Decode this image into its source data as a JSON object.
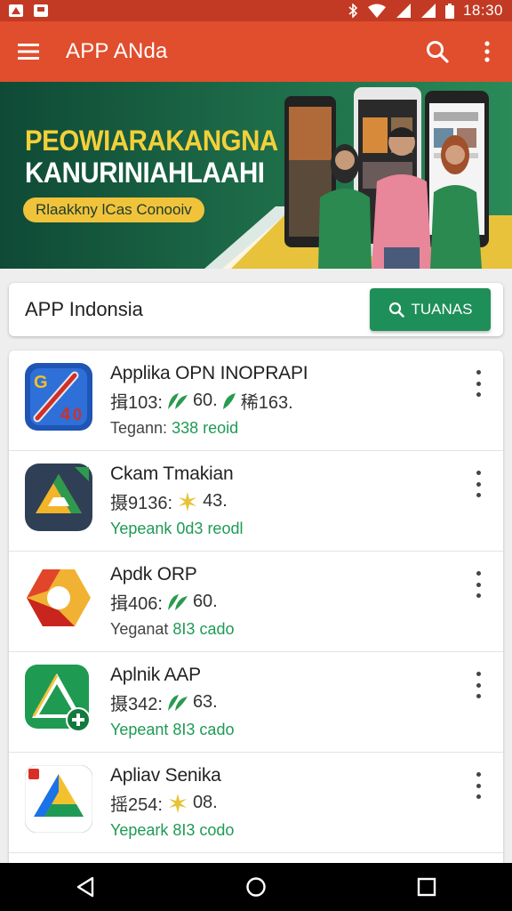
{
  "status_bar": {
    "time": "18:30",
    "icons": [
      "app-notification-icon",
      "image-notification-icon",
      "bluetooth-icon",
      "wifi-icon",
      "signal-icon",
      "signal-icon",
      "battery-icon"
    ]
  },
  "app_bar": {
    "title": "APP ANda",
    "menu_icon": "menu-icon",
    "search_icon": "search-icon",
    "more_icon": "more-vert-icon",
    "color": "#e04e2d"
  },
  "banner": {
    "headline_1": "PEOWIARAKANGNA",
    "headline_2": "KANURINIAHLAAHI",
    "pill_text": "Rlaakkny lCas Conooiv",
    "colors": {
      "green": "#17523d",
      "yellow": "#f1c33a"
    }
  },
  "search_card": {
    "label": "APP Indonsia",
    "button_label": "TUANAS",
    "button_color": "#1e8f58"
  },
  "apps": [
    {
      "name": "Applika OPN INOPRAPI",
      "stats_a": "揖103:",
      "stats_b": "60.",
      "stats_c": "稀163.",
      "sub_a": "Tegann: ",
      "sub_b": "338 reoid",
      "icon": "app-icon-blue-red"
    },
    {
      "name": "Ckam Tmakian",
      "stats_a": "摄9136:",
      "stats_b": "43.",
      "stats_c": "",
      "sub_a": "",
      "sub_b": "Yepeank 0d3 reodl",
      "icon": "app-icon-drive-dark"
    },
    {
      "name": "Apdk ORP",
      "stats_a": "揖406:",
      "stats_b": "60.",
      "stats_c": "",
      "sub_a": "Yeganat ",
      "sub_b": "8I3 cado",
      "icon": "app-icon-red-yellow"
    },
    {
      "name": "Aplnik AAP",
      "stats_a": "摄342:",
      "stats_b": "63.",
      "stats_c": "",
      "sub_a": "",
      "sub_b": "Yepeant 8I3 cado",
      "icon": "app-icon-green-plus"
    },
    {
      "name": "Apliav Senika",
      "stats_a": "摇254:",
      "stats_b": "08.",
      "stats_c": "",
      "sub_a": "",
      "sub_b": "Yepeark 8I3 codo",
      "icon": "app-icon-drive-color"
    }
  ],
  "nav_bar": {
    "back": "back-icon",
    "home": "home-icon",
    "recents": "recents-icon"
  }
}
